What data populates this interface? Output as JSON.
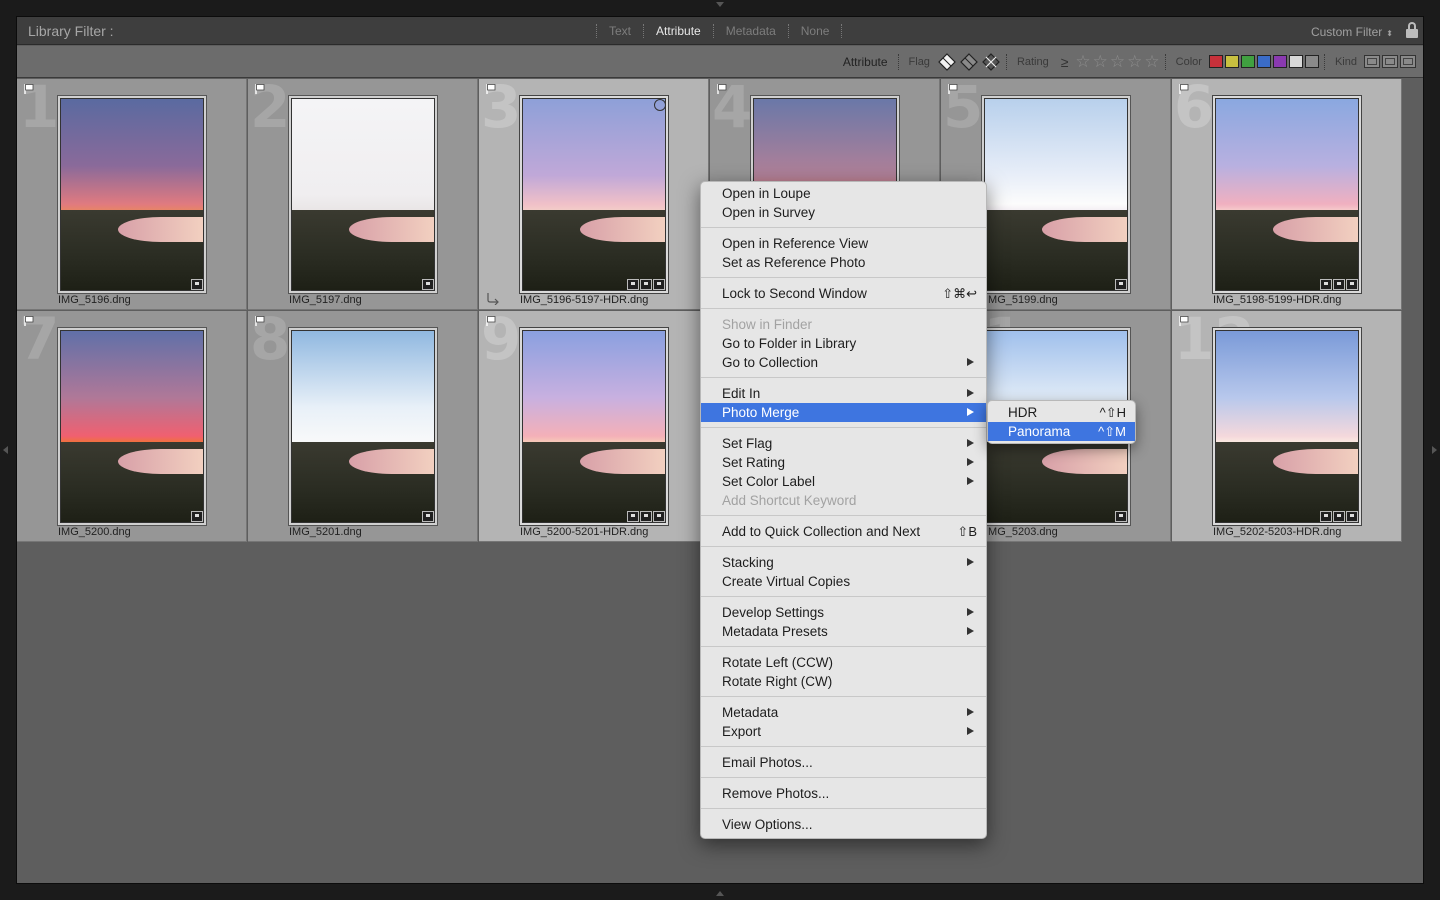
{
  "filter_bar": {
    "title": "Library Filter :",
    "tabs": [
      "Text",
      "Attribute",
      "Metadata",
      "None"
    ],
    "active_tab": "Attribute",
    "custom_filter": "Custom Filter"
  },
  "attribute_bar": {
    "label": "Attribute",
    "flag_label": "Flag",
    "rating_label": "Rating",
    "rating_op": "≥",
    "color_label": "Color",
    "kind_label": "Kind",
    "color_swatches": [
      "#c8303a",
      "#c8c040",
      "#40a040",
      "#3a6cc8",
      "#8a3ab0",
      "#d8d8d8",
      "#8a8a8a"
    ]
  },
  "grid": {
    "cells": [
      {
        "index": "1",
        "filename": "IMG_5196.dng",
        "selected": false
      },
      {
        "index": "2",
        "filename": "IMG_5197.dng",
        "selected": false
      },
      {
        "index": "3",
        "filename": "IMG_5196-5197-HDR.dng",
        "selected": true
      },
      {
        "index": "4",
        "filename": "",
        "selected": false
      },
      {
        "index": "5",
        "filename": "IMG_5199.dng",
        "selected": false
      },
      {
        "index": "6",
        "filename": "IMG_5198-5199-HDR.dng",
        "selected": true
      },
      {
        "index": "7",
        "filename": "IMG_5200.dng",
        "selected": false
      },
      {
        "index": "8",
        "filename": "IMG_5201.dng",
        "selected": false
      },
      {
        "index": "9",
        "filename": "IMG_5200-5201-HDR.dng",
        "selected": true
      },
      {
        "index": "10",
        "filename": "",
        "selected": false
      },
      {
        "index": "11",
        "filename": "IMG_5203.dng",
        "selected": false
      },
      {
        "index": "12",
        "filename": "IMG_5202-5203-HDR.dng",
        "selected": true
      }
    ]
  },
  "context_menu": {
    "items": {
      "open_loupe": "Open in Loupe",
      "open_survey": "Open in Survey",
      "open_reference": "Open in Reference View",
      "set_reference": "Set as Reference Photo",
      "lock_second": "Lock to Second Window",
      "lock_second_shortcut": "⇧⌘↩",
      "show_finder": "Show in Finder",
      "go_folder": "Go to Folder in Library",
      "go_collection": "Go to Collection",
      "edit_in": "Edit In",
      "photo_merge": "Photo Merge",
      "set_flag": "Set Flag",
      "set_rating": "Set Rating",
      "set_color": "Set Color Label",
      "add_keyword": "Add Shortcut Keyword",
      "quick_collection": "Add to Quick Collection and Next",
      "quick_collection_shortcut": "⇧B",
      "stacking": "Stacking",
      "virtual_copies": "Create Virtual Copies",
      "develop_settings": "Develop Settings",
      "metadata_presets": "Metadata Presets",
      "rotate_left": "Rotate Left (CCW)",
      "rotate_right": "Rotate Right (CW)",
      "metadata": "Metadata",
      "export": "Export",
      "email": "Email Photos...",
      "remove": "Remove Photos...",
      "view_options": "View Options..."
    }
  },
  "photo_merge_submenu": {
    "hdr": "HDR",
    "hdr_shortcut": "^⇧H",
    "panorama": "Panorama",
    "panorama_shortcut": "^⇧M"
  }
}
